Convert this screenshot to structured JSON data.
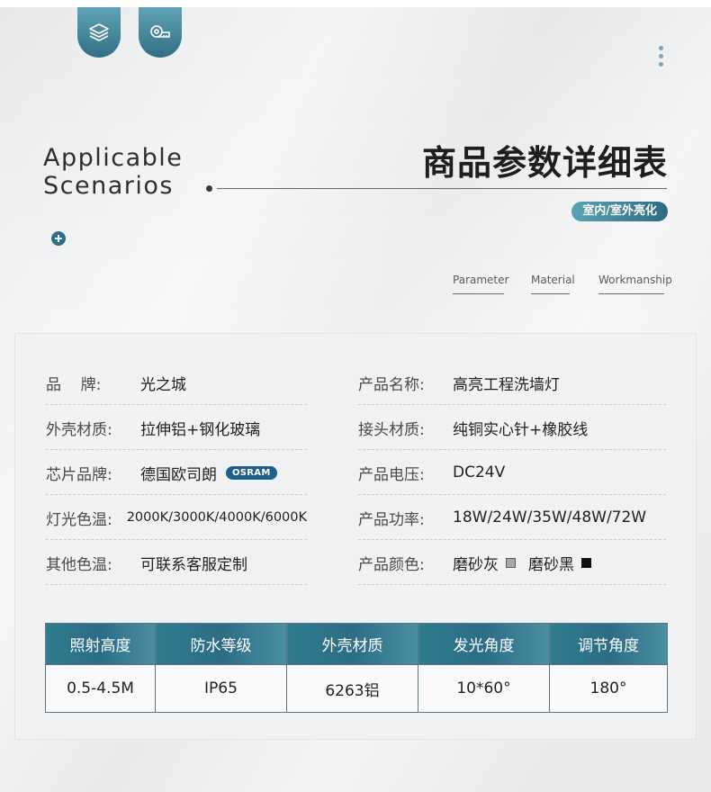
{
  "header": {
    "icons": [
      "layers-icon",
      "tape-measure-icon"
    ],
    "en_title": "Applicable\nScenarios",
    "cn_title": "商品参数详细表",
    "badge": "室内/室外亮化"
  },
  "subnav": {
    "items": [
      "Parameter",
      "Material",
      "Workmanship"
    ]
  },
  "specs": {
    "left": [
      {
        "label": "品    牌:",
        "value": "光之城"
      },
      {
        "label": "外壳材质:",
        "value": "拉伸铝+钢化玻璃"
      },
      {
        "label": "芯片品牌:",
        "value": "德国欧司朗",
        "badge": "OSRAM"
      },
      {
        "label": "灯光色温:",
        "value": "2000K/3000K/4000K/6000K"
      },
      {
        "label": "其他色温:",
        "value": "可联系客服定制"
      }
    ],
    "right": [
      {
        "label": "产品名称:",
        "value": "高亮工程洗墙灯"
      },
      {
        "label": "接头材质:",
        "value": "纯铜实心针+橡胶线"
      },
      {
        "label": "产品电压:",
        "value": "DC24V"
      },
      {
        "label": "产品功率:",
        "value": "18W/24W/35W/48W/72W"
      },
      {
        "label": "产品颜色:",
        "colors": [
          "磨砂灰",
          "磨砂黑"
        ]
      }
    ]
  },
  "table": {
    "headers": [
      "照射高度",
      "防水等级",
      "外壳材质",
      "发光角度",
      "调节角度"
    ],
    "values": [
      "0.5-4.5M",
      "IP65",
      "6263铝",
      "10*60°",
      "180°"
    ]
  },
  "colors": {
    "accent": "#2f7b8e",
    "accent_light": "#5fa3b5",
    "swatch_gray": "#a8a8a8",
    "swatch_black": "#111111"
  }
}
